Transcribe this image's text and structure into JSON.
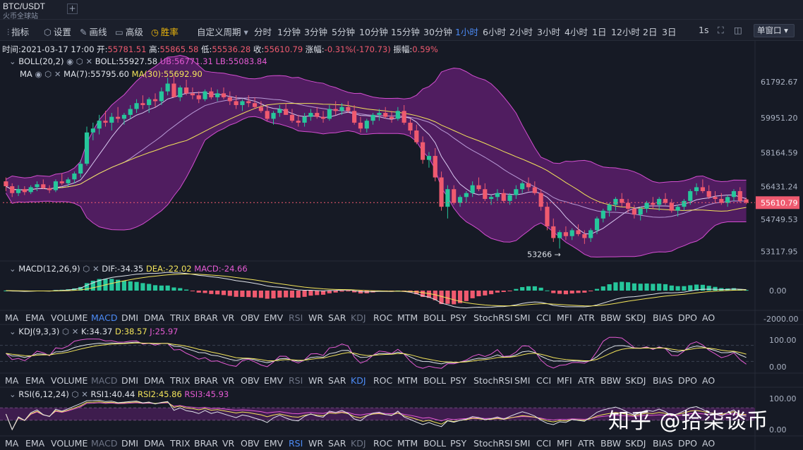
{
  "header": {
    "pair": "BTC/USDT",
    "exchange": "火币全球站",
    "add_tab": "+"
  },
  "toolbar": {
    "indicator": "指标",
    "settings": "设置",
    "draw": "画线",
    "advanced": "高级",
    "winrate": "胜率",
    "custom_period": "自定义周期",
    "periods": [
      "分时",
      "1分钟",
      "3分钟",
      "5分钟",
      "10分钟",
      "15分钟",
      "30分钟",
      "1小时",
      "6小时",
      "2小时",
      "3小时",
      "4小时",
      "1日",
      "12小时",
      "2日",
      "3日"
    ],
    "active_period": "1小时",
    "seconds": "1s",
    "window_mode": "单窗口"
  },
  "ohlc": {
    "time_label": "时间:",
    "time": "2021-03-17 17:00",
    "open_label": "开:",
    "open": "55781.51",
    "high_label": "高:",
    "high": "55865.58",
    "low_label": "低:",
    "low": "55536.28",
    "close_label": "收:",
    "close": "55610.79",
    "change_label": "涨幅:",
    "change": "-0.31%(-170.73)",
    "amp_label": "振幅:",
    "amp": "0.59%"
  },
  "boll": {
    "name": "BOLL(20,2)",
    "mid": "BOLL:55927.58",
    "ub": "UB:56771.31",
    "lb": "LB:55083.84"
  },
  "ma": {
    "name": "MA",
    "ma7": "MA(7):55795.60",
    "ma30": "MA(30):55692.90"
  },
  "price_axis": {
    "ticks": [
      "61792.67",
      "59951.20",
      "58164.59",
      "56431.24",
      "55610.79",
      "54749.53",
      "53117.95"
    ],
    "last": "55610.79"
  },
  "low_marker": "53266",
  "macd": {
    "name": "MACD(12,26,9)",
    "dif": "DIF:-34.35",
    "dea": "DEA:-22.02",
    "macd": "MACD:-24.66",
    "ticks": [
      "0.00",
      "-2000.00"
    ]
  },
  "kdj": {
    "name": "KDJ(9,3,3)",
    "k": "K:34.37",
    "d": "D:38.57",
    "j": "J:25.97",
    "ticks": [
      "100.00",
      "0.00"
    ]
  },
  "rsi": {
    "name": "RSI(6,12,24)",
    "rsi1": "RSI1:40.44",
    "rsi2": "RSI2:45.86",
    "rsi3": "RSI3:45.93",
    "ticks": [
      "100.00",
      "0.00"
    ]
  },
  "indicator_tabs": [
    "MA",
    "EMA",
    "VOLUME",
    "MACD",
    "DMI",
    "DMA",
    "TRIX",
    "BRAR",
    "VR",
    "OBV",
    "EMV",
    "RSI",
    "WR",
    "SAR",
    "KDJ",
    "ROC",
    "MTM",
    "BOLL",
    "PSY",
    "StochRSI",
    "SMI",
    "CCI",
    "MFI",
    "ATR",
    "BBW",
    "SKDJ",
    "BIAS",
    "DPO",
    "AO"
  ],
  "watermark": "知乎 @拾柒谈币",
  "colors": {
    "up": "#26c69b",
    "down": "#ef5a6f",
    "boll_fill": "#5a1f6b",
    "boll_line": "#d24fd0",
    "ma7": "#d8c9f0",
    "ma30": "#f3e45a",
    "active": "#4c8bf5"
  },
  "chart_data": {
    "type": "candlestick",
    "interval": "1小时",
    "ylim": [
      52700,
      62800
    ],
    "candles": [
      [
        56700,
        56900,
        56200,
        56450
      ],
      [
        56450,
        56600,
        55900,
        56100
      ],
      [
        56100,
        56500,
        55950,
        56300
      ],
      [
        56300,
        56450,
        56000,
        56150
      ],
      [
        56150,
        56500,
        56050,
        56400
      ],
      [
        56400,
        56700,
        56200,
        56550
      ],
      [
        56550,
        56800,
        56300,
        56350
      ],
      [
        56350,
        56500,
        56100,
        56250
      ],
      [
        56250,
        56800,
        56150,
        56700
      ],
      [
        56700,
        57100,
        56500,
        56600
      ],
      [
        56600,
        56900,
        56450,
        56800
      ],
      [
        56800,
        57200,
        56600,
        57100
      ],
      [
        57100,
        57800,
        56900,
        57600
      ],
      [
        57600,
        59500,
        57500,
        59200
      ],
      [
        59200,
        59700,
        58800,
        59400
      ],
      [
        59400,
        60100,
        59100,
        59800
      ],
      [
        59800,
        60300,
        59500,
        59700
      ],
      [
        59700,
        60200,
        59300,
        60000
      ],
      [
        60000,
        60500,
        59700,
        59900
      ],
      [
        59900,
        60200,
        59600,
        60100
      ],
      [
        60100,
        60600,
        59900,
        60400
      ],
      [
        60400,
        60900,
        60200,
        60700
      ],
      [
        60700,
        61100,
        60400,
        60600
      ],
      [
        60600,
        61000,
        60200,
        60900
      ],
      [
        60900,
        61200,
        60500,
        60800
      ],
      [
        60800,
        61500,
        60600,
        61300
      ],
      [
        61300,
        62000,
        61100,
        61700
      ],
      [
        61700,
        62100,
        61200,
        61000
      ],
      [
        61000,
        61600,
        60800,
        61500
      ],
      [
        61500,
        61900,
        61100,
        61200
      ],
      [
        61200,
        61500,
        60900,
        61100
      ],
      [
        61100,
        61300,
        60700,
        60900
      ],
      [
        60900,
        61400,
        60800,
        61300
      ],
      [
        61300,
        61500,
        60900,
        61000
      ],
      [
        61000,
        61400,
        60800,
        61200
      ],
      [
        61200,
        61500,
        60900,
        61000
      ],
      [
        61000,
        61300,
        60600,
        60800
      ],
      [
        60800,
        61100,
        60400,
        60600
      ],
      [
        60600,
        60900,
        60300,
        60800
      ],
      [
        60800,
        61100,
        60500,
        60700
      ],
      [
        60700,
        61000,
        60400,
        60500
      ],
      [
        60500,
        60800,
        60200,
        60300
      ],
      [
        60300,
        60600,
        59800,
        59900
      ],
      [
        59900,
        60300,
        59600,
        60200
      ],
      [
        60200,
        60600,
        60000,
        60400
      ],
      [
        60400,
        60700,
        60100,
        60100
      ],
      [
        60100,
        60400,
        59700,
        59800
      ],
      [
        59800,
        60100,
        59500,
        59700
      ],
      [
        59700,
        60200,
        59500,
        60000
      ],
      [
        60000,
        60400,
        59800,
        60200
      ],
      [
        60200,
        60500,
        59900,
        60000
      ],
      [
        60000,
        60300,
        59700,
        59900
      ],
      [
        59900,
        60600,
        59800,
        60400
      ],
      [
        60400,
        60800,
        60100,
        60300
      ],
      [
        60300,
        60700,
        60100,
        60500
      ],
      [
        60500,
        60800,
        60200,
        60300
      ],
      [
        60300,
        60600,
        59600,
        59700
      ],
      [
        59700,
        60000,
        59200,
        59400
      ],
      [
        59400,
        59900,
        59200,
        59800
      ],
      [
        59800,
        60200,
        59600,
        60100
      ],
      [
        60100,
        60400,
        59800,
        60200
      ],
      [
        60200,
        60500,
        59900,
        60000
      ],
      [
        60000,
        60300,
        59700,
        59900
      ],
      [
        59900,
        60500,
        59800,
        60300
      ],
      [
        60300,
        60600,
        59600,
        59700
      ],
      [
        59700,
        59900,
        59100,
        59300
      ],
      [
        59300,
        59600,
        58600,
        58700
      ],
      [
        58700,
        59000,
        57600,
        57800
      ],
      [
        57800,
        58200,
        57400,
        58000
      ],
      [
        58000,
        58400,
        56700,
        56900
      ],
      [
        56900,
        57200,
        55200,
        55400
      ],
      [
        55400,
        56500,
        54800,
        56300
      ],
      [
        56300,
        56500,
        55500,
        55600
      ],
      [
        55600,
        56000,
        55400,
        55900
      ],
      [
        55900,
        56200,
        55600,
        56100
      ],
      [
        56100,
        56700,
        55900,
        56500
      ],
      [
        56500,
        56900,
        56200,
        56300
      ],
      [
        56300,
        56600,
        55700,
        55800
      ],
      [
        55800,
        56000,
        55500,
        55900
      ],
      [
        55900,
        56300,
        55700,
        56100
      ],
      [
        56100,
        56300,
        55600,
        55700
      ],
      [
        55700,
        56100,
        55500,
        56000
      ],
      [
        56000,
        56500,
        55800,
        56300
      ],
      [
        56300,
        56700,
        56100,
        56600
      ],
      [
        56600,
        56900,
        56200,
        56400
      ],
      [
        56400,
        56700,
        56000,
        56100
      ],
      [
        56100,
        56300,
        55200,
        55400
      ],
      [
        55400,
        55600,
        54200,
        54400
      ],
      [
        54400,
        54800,
        53600,
        53800
      ],
      [
        53800,
        54200,
        53266,
        54100
      ],
      [
        54100,
        54400,
        53700,
        53900
      ],
      [
        53900,
        54300,
        53700,
        54200
      ],
      [
        54200,
        54500,
        53900,
        54000
      ],
      [
        54000,
        54200,
        53500,
        53800
      ],
      [
        53800,
        54300,
        53600,
        54200
      ],
      [
        54200,
        54900,
        54000,
        54800
      ],
      [
        54800,
        55300,
        54600,
        55200
      ],
      [
        55200,
        55600,
        54900,
        55500
      ],
      [
        55500,
        55900,
        55200,
        55800
      ],
      [
        55800,
        56100,
        55400,
        55600
      ],
      [
        55600,
        55800,
        55100,
        55300
      ],
      [
        55300,
        55500,
        54800,
        55000
      ],
      [
        55000,
        55400,
        54700,
        55300
      ],
      [
        55300,
        55700,
        55100,
        55600
      ],
      [
        55600,
        55900,
        55300,
        55500
      ],
      [
        55500,
        55900,
        55200,
        55800
      ],
      [
        55800,
        56100,
        55500,
        55600
      ],
      [
        55600,
        55800,
        55100,
        55200
      ],
      [
        55200,
        55500,
        54900,
        55400
      ],
      [
        55400,
        55800,
        55200,
        55700
      ],
      [
        55700,
        56300,
        55500,
        56200
      ],
      [
        56200,
        56600,
        56000,
        56400
      ],
      [
        56400,
        56800,
        56100,
        56200
      ],
      [
        56200,
        56500,
        55800,
        55900
      ],
      [
        55900,
        56200,
        55600,
        55800
      ],
      [
        55800,
        56100,
        55500,
        55600
      ],
      [
        55600,
        56000,
        55400,
        55900
      ],
      [
        55900,
        56300,
        55700,
        56200
      ],
      [
        56200,
        56400,
        55600,
        55700
      ],
      [
        55781.51,
        55865.58,
        55536.28,
        55610.79
      ]
    ]
  }
}
